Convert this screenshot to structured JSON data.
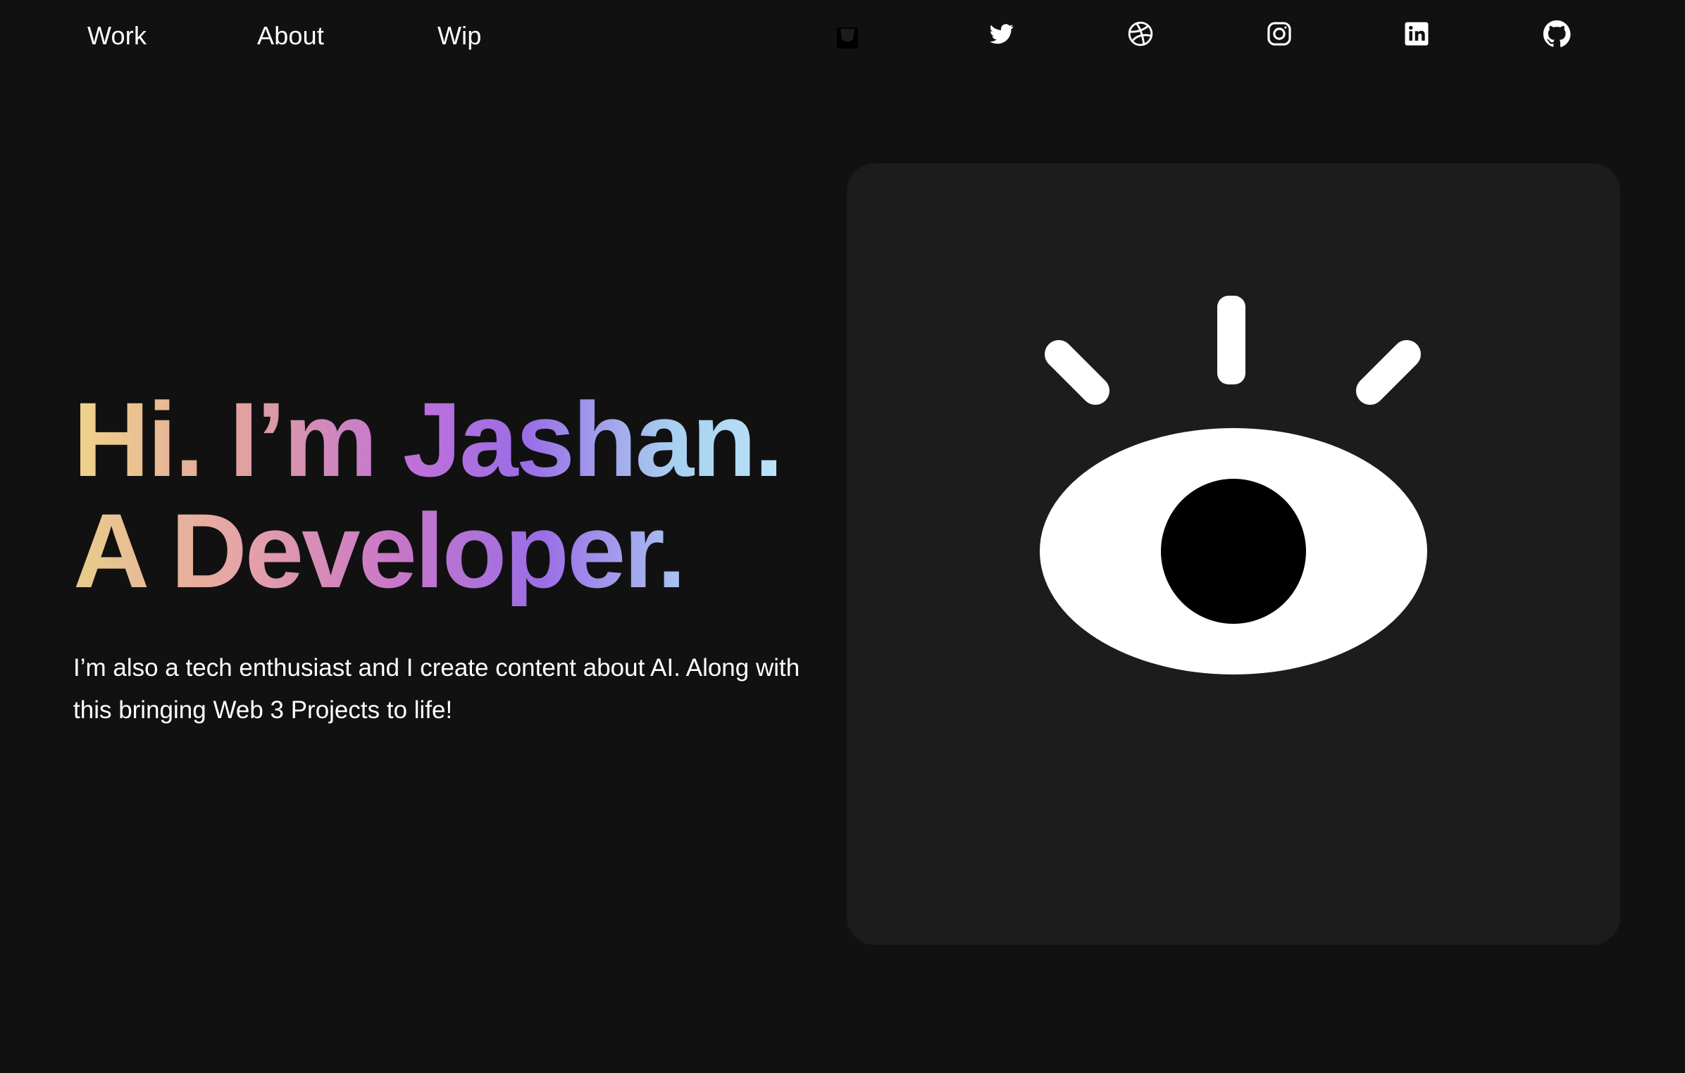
{
  "nav": {
    "links": [
      {
        "label": "Work"
      },
      {
        "label": "About"
      },
      {
        "label": "Wip"
      }
    ],
    "social": [
      {
        "icon": "buy-me-a-coffee-icon"
      },
      {
        "icon": "twitter-icon"
      },
      {
        "icon": "dribbble-icon"
      },
      {
        "icon": "instagram-icon"
      },
      {
        "icon": "linkedin-icon"
      },
      {
        "icon": "github-icon"
      }
    ]
  },
  "hero": {
    "headline_line1": "Hi. I’m Jashan.",
    "headline_line2": "A Developer.",
    "subtitle": "I’m also a tech enthusiast and I create content about AI. Along with this bringing Web 3 Projects to life!"
  },
  "illustration": {
    "icon": "eye-icon"
  },
  "colors": {
    "background": "#111111",
    "card": "#1c1c1c",
    "text": "#ffffff",
    "gradient": [
      "#f0d48a",
      "#e0a0a0",
      "#c070d8",
      "#9a6ee6",
      "#bfe9f8"
    ]
  }
}
